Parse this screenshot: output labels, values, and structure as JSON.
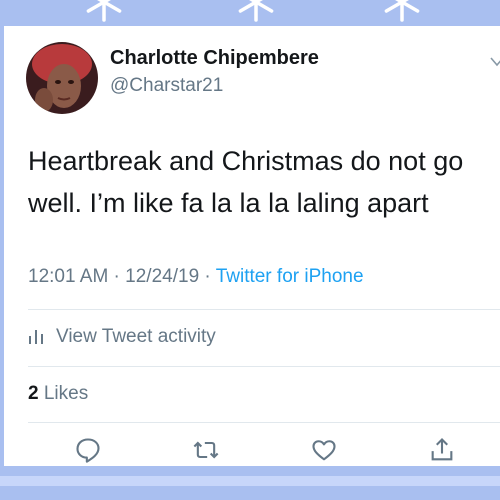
{
  "user": {
    "name": "Charlotte Chipembere",
    "handle": "@Charstar21"
  },
  "tweet": {
    "text": "Heartbreak and Christmas do not go well. I’m like fa la la la laling apart",
    "time": "12:01 AM",
    "sep1": " · ",
    "date": "12/24/19",
    "sep2": " · ",
    "source": "Twitter for iPhone"
  },
  "activity": {
    "label": "View Tweet activity"
  },
  "likes": {
    "count": "2",
    "label": "Likes"
  },
  "icons": {
    "reply": "reply-icon",
    "retweet": "retweet-icon",
    "like": "heart-icon",
    "share": "share-icon",
    "menu": "chevron-down-icon",
    "activity": "analytics-icon",
    "decor": "snowflake-icon"
  },
  "colors": {
    "background": "#a9bff0",
    "link": "#1da1f2",
    "secondary_text": "#657786",
    "primary_text": "#14171a"
  }
}
